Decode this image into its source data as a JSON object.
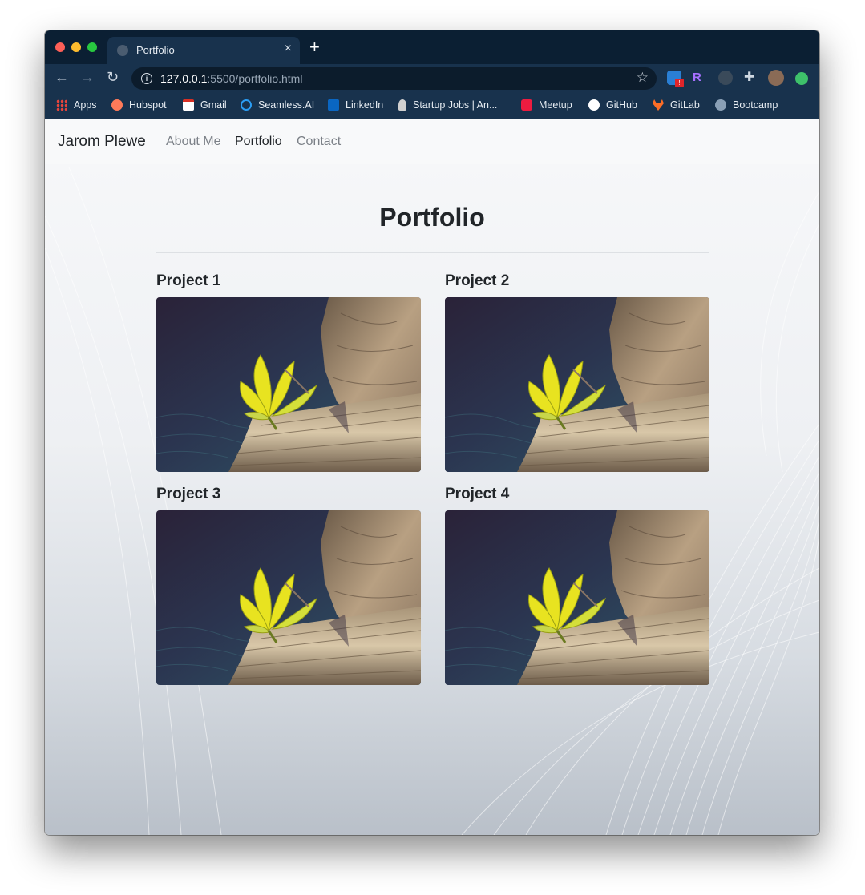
{
  "browser": {
    "tab_title": "Portfolio",
    "tab_close": "×",
    "new_tab": "+",
    "url_host": "127.0.0.1",
    "url_rest": ":5500/portfolio.html",
    "back": "←",
    "forward": "→",
    "reload": "↻",
    "star": "☆",
    "extension_badge": "!",
    "extension_r": "R",
    "extension_puzzle": "✚",
    "bookmarks": [
      {
        "label": "Apps",
        "icon": "apps-grid-icon",
        "color": "#e8453c"
      },
      {
        "label": "Hubspot",
        "icon": "hubspot-icon",
        "color": "#ff7a59"
      },
      {
        "label": "Gmail",
        "icon": "gmail-icon",
        "color": "#d93025"
      },
      {
        "label": "Seamless.AI",
        "icon": "seamless-icon",
        "color": "#2a9df4"
      },
      {
        "label": "LinkedIn",
        "icon": "linkedin-icon",
        "color": "#0a66c2"
      },
      {
        "label": "Startup Jobs | An...",
        "icon": "startup-jobs-icon",
        "color": "#d0d0d0"
      },
      {
        "label": "Meetup",
        "icon": "meetup-icon",
        "color": "#ed1c40"
      },
      {
        "label": "GitHub",
        "icon": "github-icon",
        "color": "#ffffff"
      },
      {
        "label": "GitLab",
        "icon": "gitlab-icon",
        "color": "#fc6d26"
      },
      {
        "label": "Bootcamp",
        "icon": "globe-icon",
        "color": "#8aa0b6"
      }
    ]
  },
  "site": {
    "brand": "Jarom Plewe",
    "nav": [
      {
        "label": "About Me",
        "active": false
      },
      {
        "label": "Portfolio",
        "active": true
      },
      {
        "label": "Contact",
        "active": false
      }
    ],
    "heading": "Portfolio",
    "projects": [
      {
        "title": "Project 1",
        "image": "plant-on-log-photo"
      },
      {
        "title": "Project 2",
        "image": "plant-on-log-photo"
      },
      {
        "title": "Project 3",
        "image": "plant-on-log-photo"
      },
      {
        "title": "Project 4",
        "image": "plant-on-log-photo"
      }
    ]
  }
}
